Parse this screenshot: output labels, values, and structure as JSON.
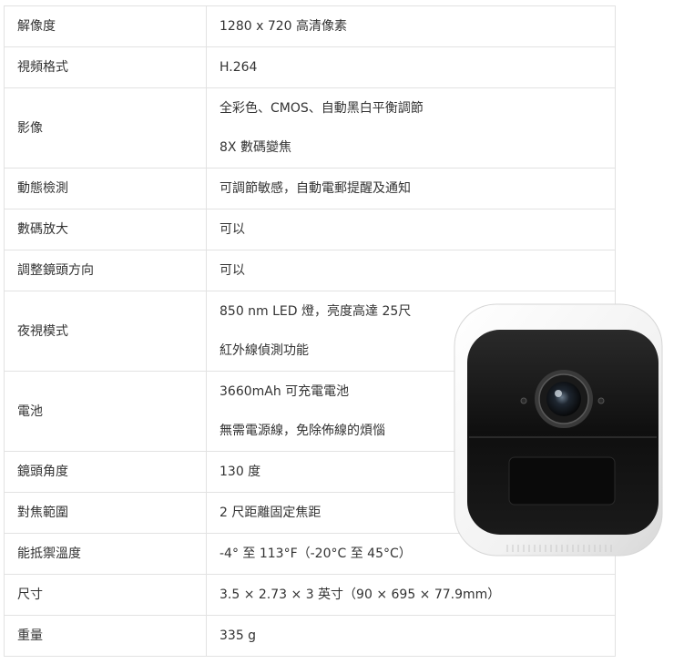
{
  "specs": [
    {
      "label": "解像度",
      "values": [
        "1280 x 720 高清像素"
      ]
    },
    {
      "label": "視頻格式",
      "values": [
        "H.264"
      ]
    },
    {
      "label": "影像",
      "values": [
        "全彩色、CMOS、自動黑白平衡調節",
        "8X 數碼變焦"
      ]
    },
    {
      "label": "動態檢測",
      "values": [
        "可調節敏感，自動電郵提醒及通知"
      ]
    },
    {
      "label": "數碼放大",
      "values": [
        "可以"
      ]
    },
    {
      "label": "調整鏡頭方向",
      "values": [
        "可以"
      ]
    },
    {
      "label": "夜視模式",
      "values": [
        "850 nm LED 燈，亮度高達 25尺",
        "紅外線偵測功能"
      ]
    },
    {
      "label": "電池",
      "values": [
        "3660mAh 可充電電池",
        "無需電源線，免除佈線的煩惱"
      ]
    },
    {
      "label": "鏡頭角度",
      "values": [
        "130 度"
      ]
    },
    {
      "label": "對焦範圍",
      "values": [
        "2 尺距離固定焦距"
      ]
    },
    {
      "label": "能抵禦溫度",
      "values": [
        "-4° 至 113°F（-20°C 至 45°C）"
      ]
    },
    {
      "label": "尺寸",
      "values": [
        "3.5 × 2.73 × 3 英寸（90 × 695 × 77.9mm）"
      ]
    },
    {
      "label": "重量",
      "values": [
        "335 g"
      ]
    }
  ],
  "colors": {
    "border": "#e2e2e2",
    "text": "#333333",
    "camera_body": "#f4f4f4",
    "camera_face": "#111111"
  }
}
